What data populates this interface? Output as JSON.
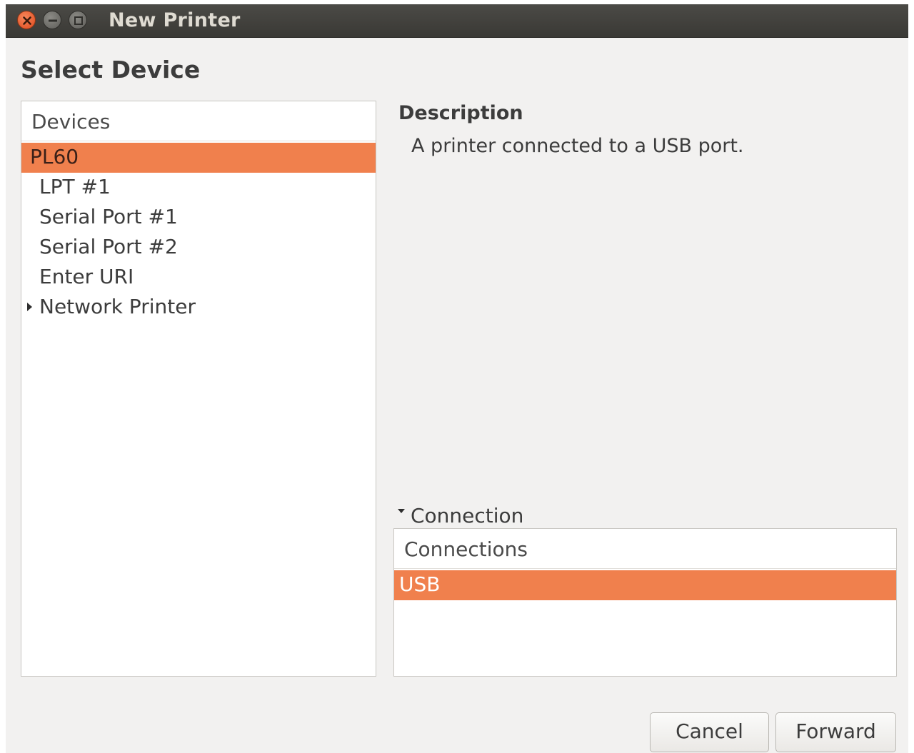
{
  "window": {
    "title": "New Printer",
    "controls": [
      "close-icon",
      "minimize-icon",
      "maximize-icon"
    ]
  },
  "page": {
    "heading": "Select Device"
  },
  "devices": {
    "header": "Devices",
    "items": [
      {
        "label": "PL60",
        "selected": true
      },
      {
        "label": "LPT #1",
        "selected": false
      },
      {
        "label": "Serial Port #1",
        "selected": false
      },
      {
        "label": "Serial Port #2",
        "selected": false
      },
      {
        "label": "Enter URI",
        "selected": false
      },
      {
        "label": "Network Printer",
        "selected": false,
        "expandable": true,
        "expanded": false
      }
    ]
  },
  "description": {
    "title": "Description",
    "text": "A printer connected to a USB port."
  },
  "connection": {
    "expander_label": "Connection",
    "expanded": true,
    "header": "Connections",
    "items": [
      {
        "label": "USB",
        "selected": true
      }
    ]
  },
  "buttons": {
    "cancel": "Cancel",
    "forward": "Forward"
  },
  "colors": {
    "selection": "#f0804d",
    "titlebar": "#3c3b37",
    "close_button": "#e95420"
  }
}
